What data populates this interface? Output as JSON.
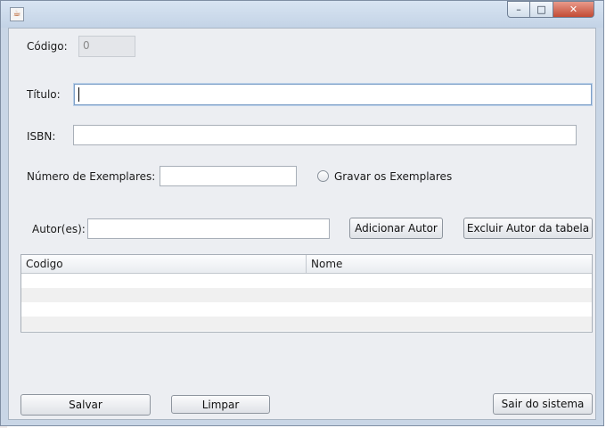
{
  "window": {
    "controls": {
      "minimize": "–",
      "maximize": "□",
      "close": "✕"
    },
    "icon": "java-icon"
  },
  "form": {
    "codigo": {
      "label": "Código:",
      "value": "0"
    },
    "titulo": {
      "label": "Título:",
      "value": ""
    },
    "isbn": {
      "label": "ISBN:",
      "value": ""
    },
    "exemplares": {
      "label": "Número de Exemplares:",
      "value": ""
    },
    "gravar_radio": {
      "label": "Gravar os Exemplares",
      "checked": false
    },
    "autores": {
      "label": "Autor(es):",
      "value": ""
    },
    "add_author_button": "Adicionar Autor",
    "remove_author_button": "Excluir Autor da tabela"
  },
  "table": {
    "columns": [
      "Codigo",
      "Nome"
    ],
    "rows": []
  },
  "footer": {
    "save_button": "Salvar",
    "clear_button": "Limpar",
    "exit_button": "Sair do sistema"
  }
}
